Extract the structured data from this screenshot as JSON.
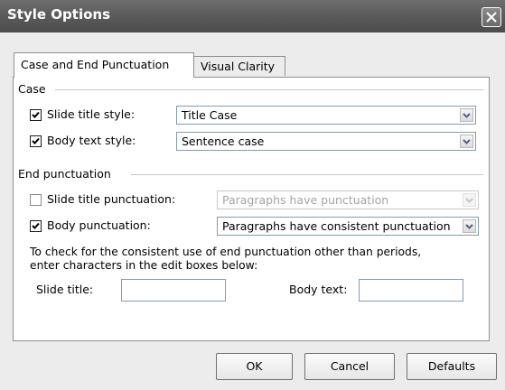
{
  "window": {
    "title": "Style Options"
  },
  "tabs": [
    {
      "label": "Case and End Punctuation",
      "active": true
    },
    {
      "label": "Visual Clarity",
      "active": false
    }
  ],
  "case": {
    "heading": "Case",
    "slide_title": {
      "label": "Slide title style:",
      "checked": true,
      "value": "Title Case"
    },
    "body_text": {
      "label": "Body text style:",
      "checked": true,
      "value": "Sentence case"
    }
  },
  "end_punctuation": {
    "heading": "End punctuation",
    "slide_title": {
      "label": "Slide title punctuation:",
      "checked": false,
      "enabled": false,
      "value": "Paragraphs have punctuation"
    },
    "body": {
      "label": "Body punctuation:",
      "checked": true,
      "value": "Paragraphs have consistent punctuation"
    },
    "description": {
      "line1": "To check for the consistent use of end punctuation other than periods,",
      "line2": "enter characters in the edit boxes below:"
    },
    "slide_title_chars": {
      "label": "Slide title:",
      "value": ""
    },
    "body_text_chars": {
      "label": "Body text:",
      "value": ""
    }
  },
  "buttons": {
    "ok": "OK",
    "cancel": "Cancel",
    "defaults": "Defaults"
  }
}
